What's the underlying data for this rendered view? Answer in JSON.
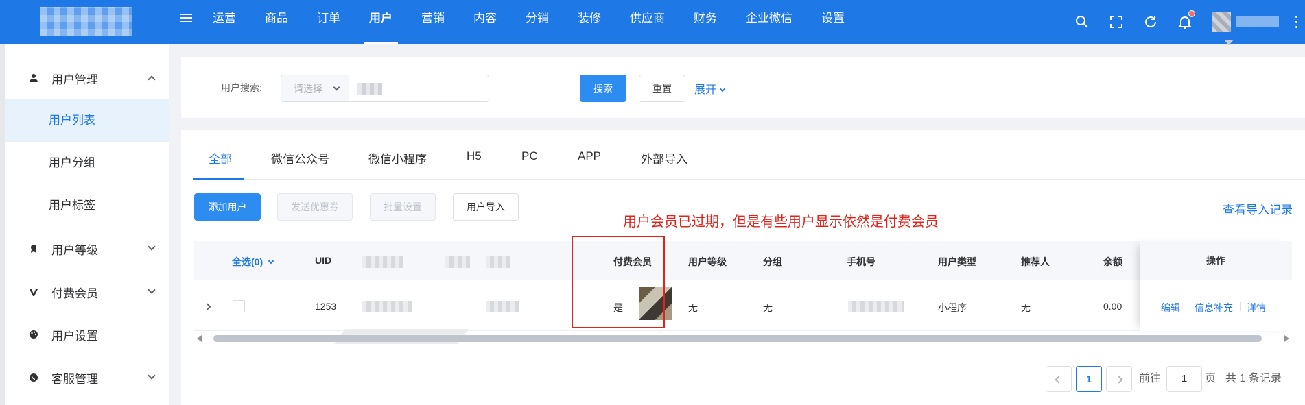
{
  "topbar": {
    "nav": [
      "运营",
      "商品",
      "订单",
      "用户",
      "营销",
      "内容",
      "分销",
      "装修",
      "供应商",
      "财务",
      "企业微信",
      "设置"
    ],
    "active_nav": "用户",
    "icons": [
      "search-icon",
      "fullscreen-icon",
      "refresh-icon",
      "bell-icon",
      "more-icon"
    ]
  },
  "sidebar": {
    "groups": [
      {
        "label": "用户管理",
        "icon": "user-icon",
        "expanded": true,
        "children": [
          "用户列表",
          "用户分组",
          "用户标签"
        ]
      },
      {
        "label": "用户等级",
        "icon": "level-icon",
        "expanded": false
      },
      {
        "label": "付费会员",
        "icon": "vip-icon",
        "expanded": false
      },
      {
        "label": "用户设置",
        "icon": "palette-icon",
        "expanded": false
      },
      {
        "label": "客服管理",
        "icon": "chat-icon",
        "expanded": false
      }
    ],
    "active_child": "用户列表"
  },
  "search": {
    "label": "用户搜索:",
    "select_placeholder": "请选择",
    "search_button": "搜索",
    "reset_button": "重置",
    "expand_link": "展开"
  },
  "tabs": [
    "全部",
    "微信公众号",
    "微信小程序",
    "H5",
    "PC",
    "APP",
    "外部导入"
  ],
  "active_tab": "全部",
  "toolbar": {
    "add_user": "添加用户",
    "send_coupon": "发送优惠券",
    "batch_settings": "批量设置",
    "import_users": "用户导入",
    "view_import_log": "查看导入记录"
  },
  "annotation": "用户会员已过期，但是有些用户显示依然是付费会员",
  "table": {
    "headers": {
      "select_all": "全选(0)",
      "uid": "UID",
      "paid_member": "付费会员",
      "user_level": "用户等级",
      "group": "分组",
      "phone": "手机号",
      "user_type": "用户类型",
      "referrer": "推荐人",
      "balance": "余额",
      "actions": "操作"
    },
    "rows": [
      {
        "uid": "1253",
        "paid_member": "是",
        "user_level": "无",
        "group": "无",
        "user_type": "小程序",
        "referrer": "无",
        "balance": "0.00",
        "actions": [
          "编辑",
          "信息补充",
          "详情"
        ]
      }
    ]
  },
  "pagination": {
    "current_page": "1",
    "goto_label": "前往",
    "goto_value": "1",
    "page_unit": "页",
    "total_text": "共 1 条记录"
  },
  "colors": {
    "primary": "#1e78e6",
    "button_primary": "#2d8cf0",
    "annotation_red": "#e0241b"
  }
}
